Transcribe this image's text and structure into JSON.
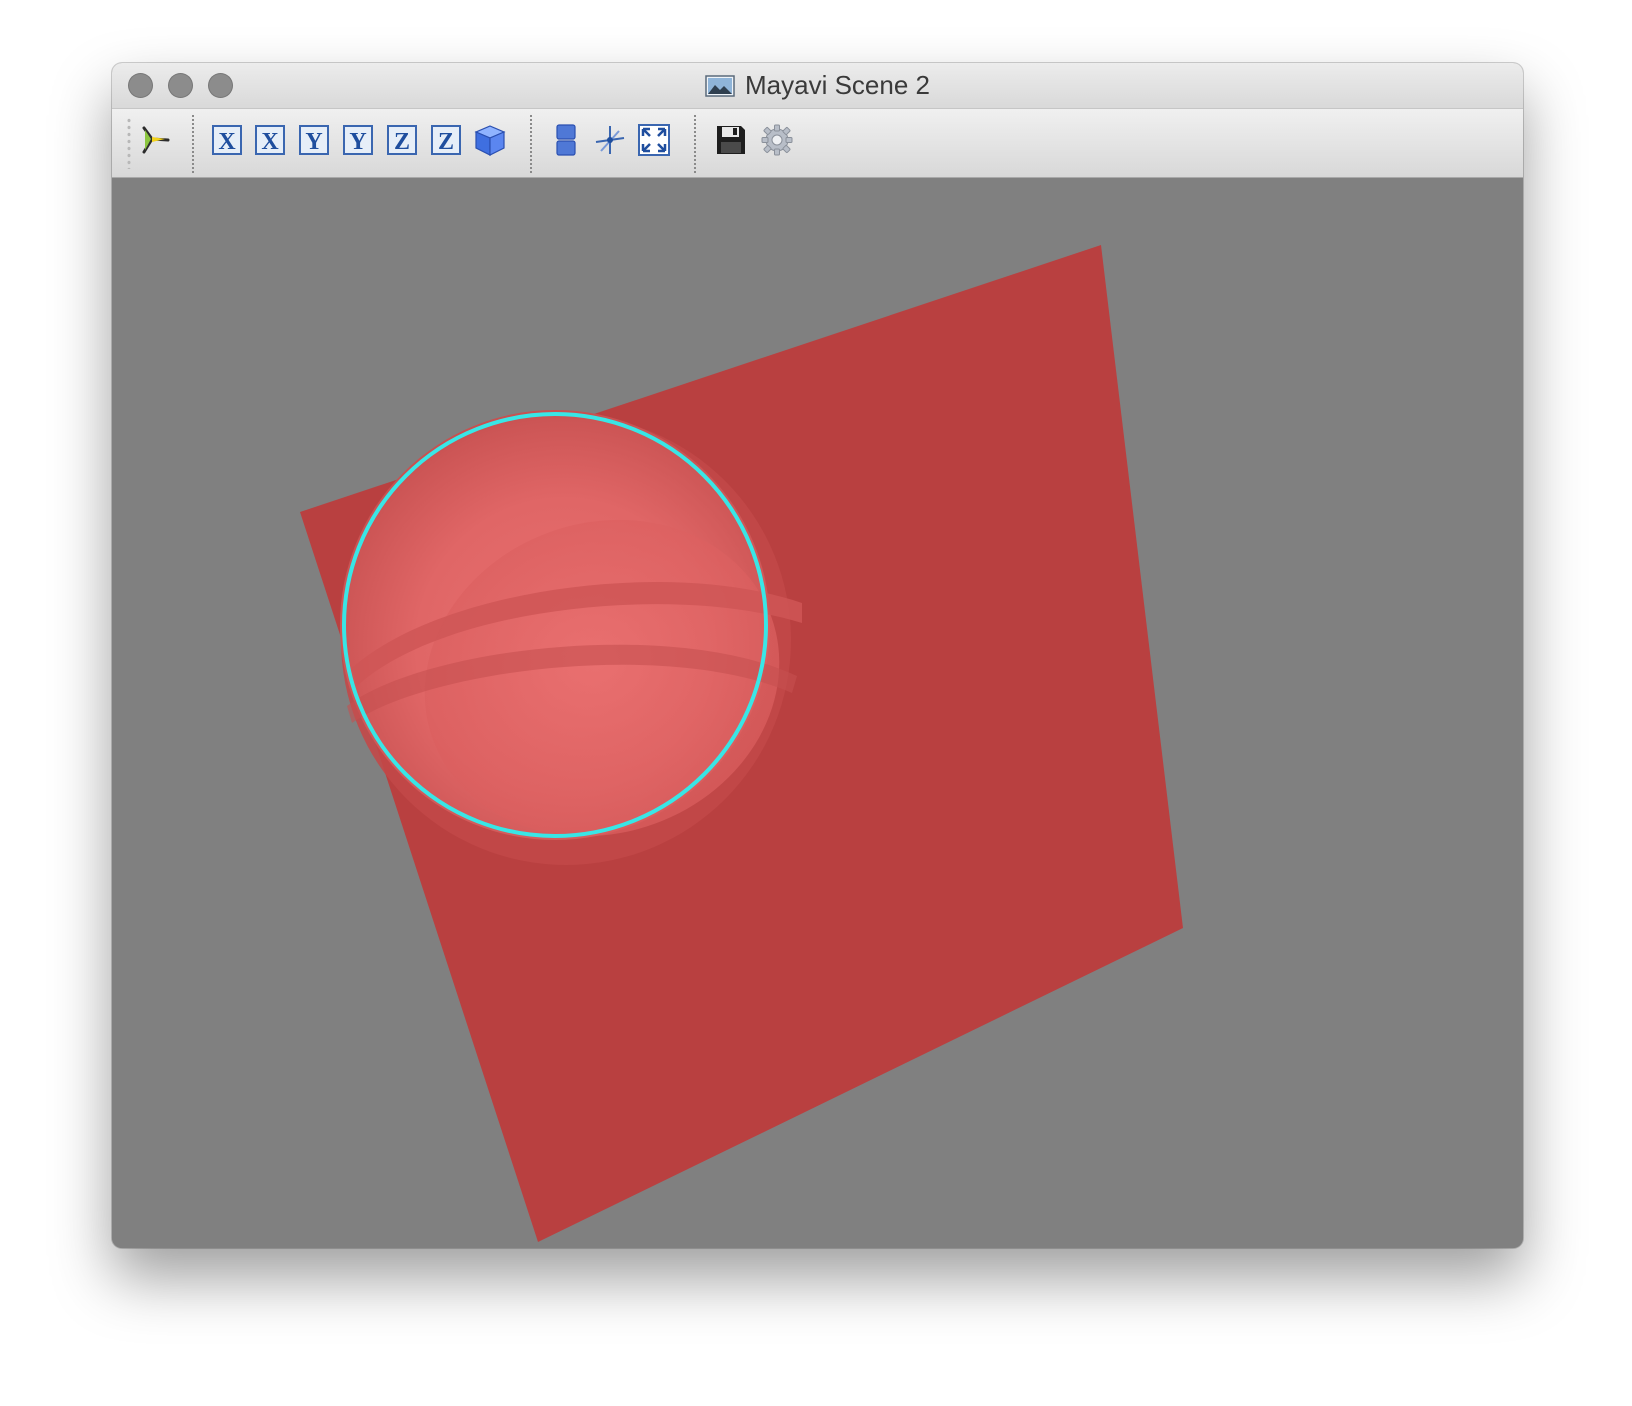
{
  "window": {
    "title": "Mayavi Scene 2"
  },
  "toolbar": {
    "buttons": [
      {
        "icon": "mayavi-pipeline-icon",
        "glyph": ""
      },
      {
        "icon": "view-x-axis-icon",
        "glyph": "X"
      },
      {
        "icon": "view-minus-x-axis-icon",
        "glyph": "X"
      },
      {
        "icon": "view-y-axis-icon",
        "glyph": "Y"
      },
      {
        "icon": "view-minus-y-axis-icon",
        "glyph": "Y"
      },
      {
        "icon": "view-z-axis-icon",
        "glyph": "Z"
      },
      {
        "icon": "view-minus-z-axis-icon",
        "glyph": "Z"
      },
      {
        "icon": "isometric-view-icon",
        "glyph": ""
      },
      {
        "icon": "parallel-projection-icon",
        "glyph": ""
      },
      {
        "icon": "toggle-axes-icon",
        "glyph": ""
      },
      {
        "icon": "full-screen-icon",
        "glyph": ""
      },
      {
        "icon": "save-icon",
        "glyph": ""
      },
      {
        "icon": "settings-gear-icon",
        "glyph": ""
      }
    ]
  },
  "scene": {
    "background_color": "#808080",
    "plane_color": "#b94040",
    "sphere_color": "#e06060",
    "ring_color": "#39e6e6"
  }
}
